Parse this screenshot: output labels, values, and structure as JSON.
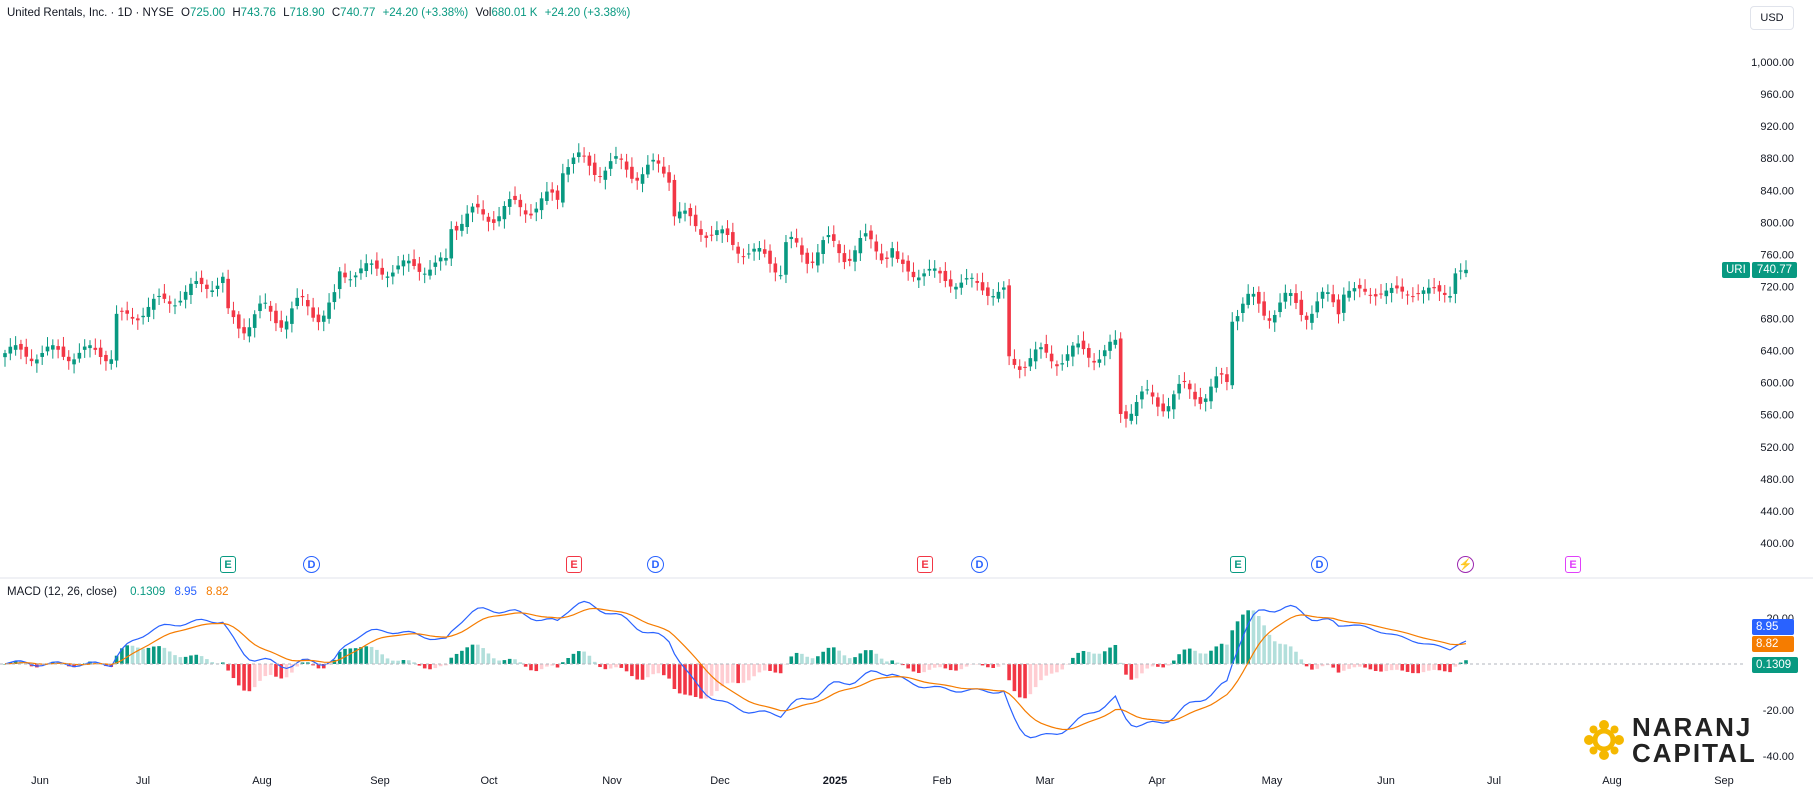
{
  "header": {
    "title": "United Rentals, Inc. · 1D · NYSE",
    "open_label": "O",
    "open": "725.00",
    "high_label": "H",
    "high": "743.76",
    "low_label": "L",
    "low": "718.90",
    "close_label": "C",
    "close": "740.77",
    "change": "+24.20 (+3.38%)",
    "vol_label": "Vol",
    "vol": "680.01 K",
    "vol_change": "+24.20 (+3.38%)"
  },
  "currency": "USD",
  "price_tag": {
    "symbol": "URI",
    "value": "740.77",
    "color": "#089981"
  },
  "macd": {
    "label": "MACD (12, 26, close)",
    "hist": "0.1309",
    "macd": "8.95",
    "signal": "8.82",
    "hist_color": "#089981",
    "macd_color": "#2962ff",
    "signal_color": "#f57c00"
  },
  "colors": {
    "up": "#089981",
    "down": "#f23645",
    "up_light": "#b2dfdb",
    "down_light": "#ffcdd2"
  },
  "events": [
    {
      "type": "E",
      "label": "E",
      "color": "#089981",
      "icon": "earnings-icon"
    },
    {
      "type": "D",
      "label": "D",
      "color": "#2962ff",
      "icon": "dividend-icon"
    },
    {
      "type": "E",
      "label": "E",
      "color": "#f23645",
      "icon": "earnings-icon"
    },
    {
      "type": "D",
      "label": "D",
      "color": "#2962ff",
      "icon": "dividend-icon"
    },
    {
      "type": "E",
      "label": "E",
      "color": "#f23645",
      "icon": "earnings-icon"
    },
    {
      "type": "D",
      "label": "D",
      "color": "#2962ff",
      "icon": "dividend-icon"
    },
    {
      "type": "E",
      "label": "E",
      "color": "#089981",
      "icon": "earnings-icon"
    },
    {
      "type": "D",
      "label": "D",
      "color": "#2962ff",
      "icon": "dividend-icon"
    },
    {
      "type": "S",
      "label": "⚡",
      "color": "#9c27b0",
      "icon": "lightning-icon"
    },
    {
      "type": "E",
      "label": "E",
      "color": "#e040fb",
      "icon": "earnings-icon"
    }
  ],
  "logo": {
    "line1": "NARANJ",
    "line2": "CAPITAL"
  },
  "chart_data": [
    {
      "type": "candlestick",
      "title": "United Rentals, Inc. · 1D · NYSE",
      "x_labels": [
        "Jun",
        "Jul",
        "Aug",
        "Sep",
        "Oct",
        "Nov",
        "Dec",
        "2025",
        "Feb",
        "Mar",
        "Apr",
        "May",
        "Jun",
        "Jul",
        "Aug",
        "Sep"
      ],
      "y_ticks": [
        "400.00",
        "440.00",
        "480.00",
        "520.00",
        "560.00",
        "600.00",
        "640.00",
        "680.00",
        "720.00",
        "760.00",
        "800.00",
        "840.00",
        "880.00",
        "920.00",
        "960.00",
        "1,000.00"
      ],
      "ylim": [
        360,
        1040
      ],
      "series": [
        {
          "name": "URI",
          "points_by_month": [
            [
              "Jun",
              660,
              700,
              615,
              628
            ],
            [
              "Jul",
              628,
              690,
              605,
              690
            ],
            [
              "Aug",
              770,
              790,
              640,
              660
            ],
            [
              "Sep",
              690,
              760,
              680,
              745
            ],
            [
              "Oct",
              760,
              860,
              750,
              800
            ],
            [
              "Nov",
              840,
              900,
              780,
              890
            ],
            [
              "Dec",
              870,
              880,
              790,
              800
            ],
            [
              "Jan",
              700,
              800,
              650,
              780
            ],
            [
              "Feb",
              790,
              795,
              720,
              740
            ],
            [
              "Mar",
              690,
              700,
              590,
              620
            ],
            [
              "Apr",
              640,
              660,
              525,
              560
            ],
            [
              "May",
              600,
              720,
              570,
              715
            ],
            [
              "Jun",
              720,
              730,
              685,
              715
            ],
            [
              "Jul-partial",
              716,
              743.76,
              690,
              740.77
            ]
          ]
        }
      ],
      "last_price": 740.77
    },
    {
      "type": "line",
      "title": "MACD (12, 26, close)",
      "y_ticks": [
        "20.00",
        "-20.00",
        "-40.00"
      ],
      "ylim": [
        -45,
        30
      ],
      "series": [
        {
          "name": "Histogram",
          "values": [
            0.1309
          ]
        },
        {
          "name": "MACD",
          "values": [
            8.95
          ]
        },
        {
          "name": "Signal",
          "values": [
            8.82
          ]
        }
      ]
    }
  ]
}
